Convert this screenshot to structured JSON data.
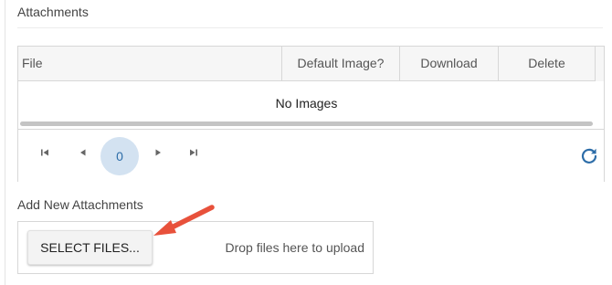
{
  "attachments": {
    "title": "Attachments",
    "grid": {
      "columns": [
        "File",
        "Default Image?",
        "Download",
        "Delete"
      ],
      "empty_message": "No Images"
    },
    "pager": {
      "current_page": "0",
      "first_icon": "first-page-icon",
      "prev_icon": "previous-page-icon",
      "next_icon": "next-page-icon",
      "last_icon": "last-page-icon",
      "refresh_icon": "refresh-icon",
      "accent": "#2d6da8"
    }
  },
  "add_new": {
    "title": "Add New Attachments",
    "select_button": "SELECT FILES...",
    "drop_hint": "Drop files here to upload"
  },
  "annotation": {
    "arrow_color": "#e8513b"
  }
}
